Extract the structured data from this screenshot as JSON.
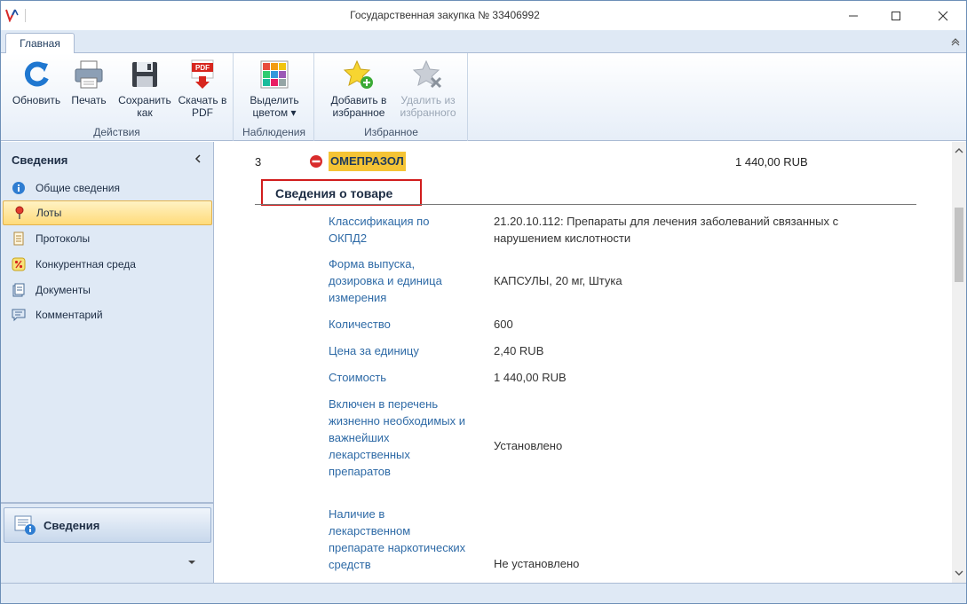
{
  "window": {
    "title": "Государственная закупка № 33406992"
  },
  "ribbon": {
    "tab": "Главная",
    "groups": [
      {
        "label": "Действия"
      },
      {
        "label": "Наблюдения"
      },
      {
        "label": "Избранное"
      }
    ],
    "buttons": {
      "refresh": "Обновить",
      "print": "Печать",
      "save_as": "Сохранить как",
      "download_pdf": "Скачать в PDF",
      "highlight_color": "Выделить цветом ▾",
      "add_favorite": "Добавить в избранное",
      "remove_favorite": "Удалить из избранного",
      "pdf_badge": "PDF"
    }
  },
  "nav": {
    "header": "Сведения",
    "items": [
      {
        "label": "Общие сведения",
        "icon": "info-icon"
      },
      {
        "label": "Лоты",
        "icon": "pin-icon",
        "active": true
      },
      {
        "label": "Протоколы",
        "icon": "document-list-icon"
      },
      {
        "label": "Конкурентная среда",
        "icon": "percent-icon"
      },
      {
        "label": "Документы",
        "icon": "documents-icon"
      },
      {
        "label": "Комментарий",
        "icon": "comment-icon"
      }
    ],
    "bottom_label": "Сведения"
  },
  "lot": {
    "number": "3",
    "name": "ОМЕПРАЗОЛ",
    "price": "1 440,00 RUB"
  },
  "section": {
    "title": "Сведения о товаре"
  },
  "properties": [
    {
      "label": "Классификация по ОКПД2",
      "value": "21.20.10.112: Препараты для лечения заболеваний связанных с нарушением кислотности"
    },
    {
      "label": "Форма выпуска, дозировка и единица измерения",
      "value": "КАПСУЛЫ, 20 мг, Штука"
    },
    {
      "label": "Количество",
      "value": "600"
    },
    {
      "label": "Цена за единицу",
      "value": "2,40 RUB"
    },
    {
      "label": "Стоимость",
      "value": "1 440,00 RUB"
    },
    {
      "label": "Включен в перечень жизненно необходимых и важнейших лекарственных препаратов",
      "value": "Установлено"
    },
    {
      "label": "Наличие в лекарственном препарате наркотических средств",
      "value": "Не установлено"
    }
  ],
  "colors": {
    "accent_blue": "#2e6aa6",
    "highlight_yellow": "#f5c435",
    "active_nav": "#ffdb7a",
    "section_border": "#d11d1d",
    "ribbon_bg": "#dfe9f5"
  }
}
